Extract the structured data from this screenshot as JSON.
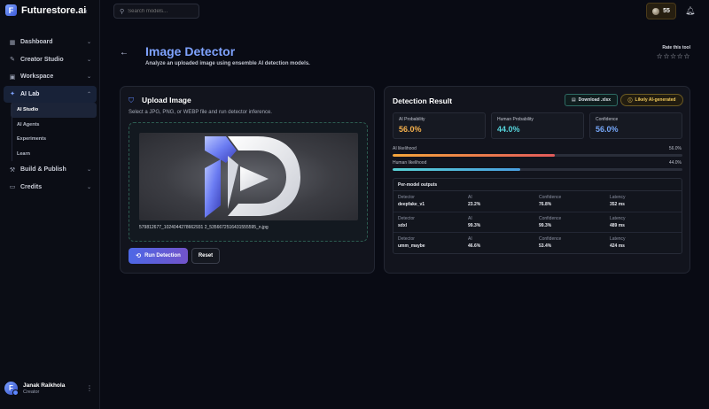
{
  "app": {
    "name": "Futurestore.ai",
    "logo_letter": "F"
  },
  "search": {
    "placeholder": "Search models..."
  },
  "credits": {
    "count": "55"
  },
  "sidebar": {
    "items": [
      {
        "label": "Dashboard"
      },
      {
        "label": "Creator Studio"
      },
      {
        "label": "Workspace"
      },
      {
        "label": "AI Lab"
      },
      {
        "label": "Build & Publish"
      },
      {
        "label": "Credits"
      }
    ],
    "ai_lab_sub": [
      {
        "label": "AI Studio"
      },
      {
        "label": "AI Agents"
      },
      {
        "label": "Experiments"
      },
      {
        "label": "Learn"
      }
    ]
  },
  "user": {
    "name": "Janak Raikhola",
    "role": "Creator",
    "initial": "F"
  },
  "header": {
    "title": "Image Detector",
    "subtitle": "Analyze an uploaded image using ensemble AI detection models.",
    "rate_label": "Rate this tool",
    "stars": "☆☆☆☆☆"
  },
  "upload": {
    "title": "Upload Image",
    "description": "Select a JPG, PNG, or WEBP file and run detector inference.",
    "filename": "579812677_1024044278662931 2_5356672516431555595_n.jpg",
    "run_label": "Run Detection",
    "reset_label": "Reset"
  },
  "result": {
    "title": "Detection Result",
    "download_label": "Download .xlsx",
    "badge_label": "Likely AI-generated",
    "metrics": [
      {
        "label": "AI Probability",
        "value": "56.0%"
      },
      {
        "label": "Human Probability",
        "value": "44.0%"
      },
      {
        "label": "Confidence",
        "value": "56.0%"
      }
    ],
    "ai_likelihood": {
      "label": "AI likelihood",
      "value": "56.0%",
      "fraction": 0.56
    },
    "human_likelihood": {
      "label": "Human likelihood",
      "value": "44.0%",
      "fraction": 0.44
    },
    "per_model_title": "Per-model outputs",
    "column_labels": {
      "detector": "Detector",
      "ai": "AI",
      "confidence": "Confidence",
      "latency": "Latency"
    },
    "rows": [
      {
        "detector": "deepfake_v1",
        "ai": "23.2%",
        "confidence": "76.8%",
        "latency": "352 ms"
      },
      {
        "detector": "sdxl",
        "ai": "99.3%",
        "confidence": "99.3%",
        "latency": "489 ms"
      },
      {
        "detector": "umm_maybe",
        "ai": "46.6%",
        "confidence": "53.4%",
        "latency": "424 ms"
      }
    ]
  },
  "colors": {
    "accent": "#7fa3ff",
    "ai_orange": "#f5b04c",
    "human_teal": "#56d5dc",
    "confidence_blue": "#75a6f8"
  }
}
